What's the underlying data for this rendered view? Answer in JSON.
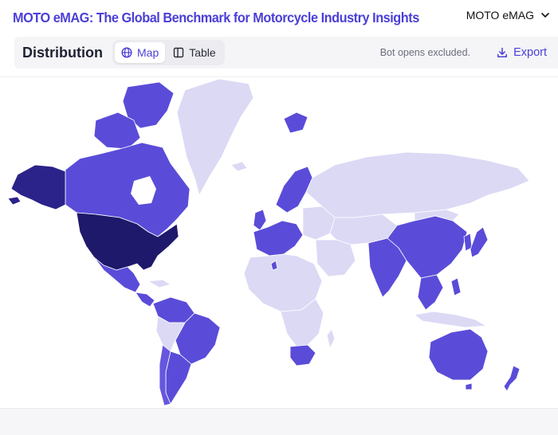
{
  "header": {
    "site_title": "MOTO eMAG: The Global Benchmark for Motorcycle Industry Insights",
    "account_label": "MOTO eMAG"
  },
  "toolbar": {
    "section_title": "Distribution",
    "tabs": [
      {
        "label": "Map",
        "icon": "globe-icon",
        "active": true
      },
      {
        "label": "Table",
        "icon": "table-icon",
        "active": false
      }
    ],
    "note": "Bot opens excluded.",
    "export_label": "Export"
  },
  "colors": {
    "accent": "#4b3fd6",
    "none": "#dcd9f5",
    "low": "#6657de",
    "mid": "#5a4cd8",
    "high": "#2b2389",
    "top": "#1f196b"
  },
  "map": {
    "type": "choropleth world map",
    "highlighted_regions": [
      {
        "region": "United States",
        "level": "top"
      },
      {
        "region": "Alaska",
        "level": "high"
      },
      {
        "region": "Canada",
        "level": "mid"
      },
      {
        "region": "Mexico",
        "level": "mid"
      },
      {
        "region": "Central America",
        "level": "mid"
      },
      {
        "region": "Colombia",
        "level": "mid"
      },
      {
        "region": "Brazil",
        "level": "mid"
      },
      {
        "region": "Argentina",
        "level": "mid"
      },
      {
        "region": "Chile",
        "level": "mid"
      },
      {
        "region": "Greenland",
        "level": "none"
      },
      {
        "region": "Scandinavia",
        "level": "mid"
      },
      {
        "region": "United Kingdom",
        "level": "mid"
      },
      {
        "region": "Western Europe",
        "level": "mid"
      },
      {
        "region": "Svalbard",
        "level": "mid"
      },
      {
        "region": "South Africa",
        "level": "mid"
      },
      {
        "region": "India",
        "level": "mid"
      },
      {
        "region": "China",
        "level": "mid"
      },
      {
        "region": "Japan",
        "level": "mid"
      },
      {
        "region": "Southeast Asia",
        "level": "mid"
      },
      {
        "region": "Australia",
        "level": "mid"
      },
      {
        "region": "New Zealand",
        "level": "mid"
      }
    ]
  }
}
